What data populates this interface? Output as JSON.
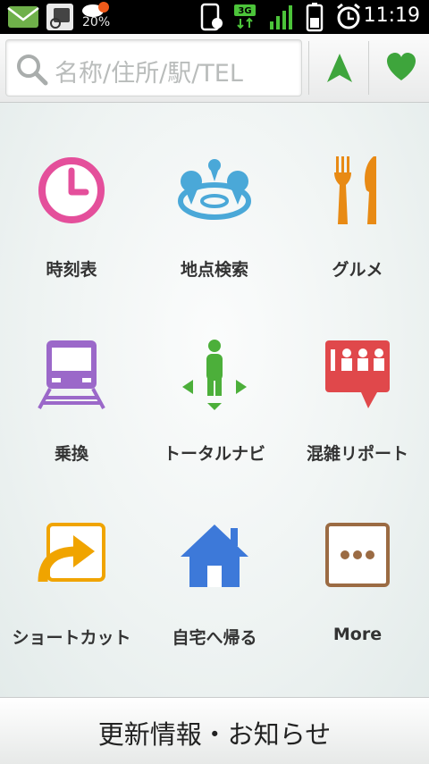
{
  "status_bar": {
    "time": "11:19",
    "weather_percent": "20%",
    "network_type": "3G",
    "icons": [
      "mail-icon",
      "sd-card-icon",
      "weather-icon",
      "phone-icon",
      "network-3g-icon",
      "signal-icon",
      "battery-icon",
      "alarm-icon"
    ]
  },
  "search": {
    "placeholder": "名称/住所/駅/TEL"
  },
  "top_buttons": {
    "navigate_icon": "navigation-arrow-icon",
    "favorite_icon": "heart-icon"
  },
  "menu": {
    "items": [
      {
        "label": "時刻表",
        "icon": "clock-icon"
      },
      {
        "label": "地点検索",
        "icon": "map-pin-search-icon"
      },
      {
        "label": "グルメ",
        "icon": "fork-knife-icon"
      },
      {
        "label": "乗換",
        "icon": "train-icon"
      },
      {
        "label": "トータルナビ",
        "icon": "person-navigation-icon"
      },
      {
        "label": "混雑リポート",
        "icon": "crowd-report-icon"
      },
      {
        "label": "ショートカット",
        "icon": "shortcut-icon"
      },
      {
        "label": "自宅へ帰る",
        "icon": "home-icon"
      },
      {
        "label": "More",
        "icon": "more-icon"
      }
    ]
  },
  "bottom": {
    "label": "更新情報・お知らせ"
  },
  "colors": {
    "clock": "#e44f9b",
    "pin": "#4aa8d8",
    "gourmet": "#e88a14",
    "train": "#9b68c9",
    "navi": "#4caf3a",
    "crowd": "#e0484b",
    "shortcut": "#f0a400",
    "home": "#3d79d9",
    "more": "#9b6b43",
    "navigate_arrow": "#3ea53c",
    "heart": "#3ea53c"
  }
}
